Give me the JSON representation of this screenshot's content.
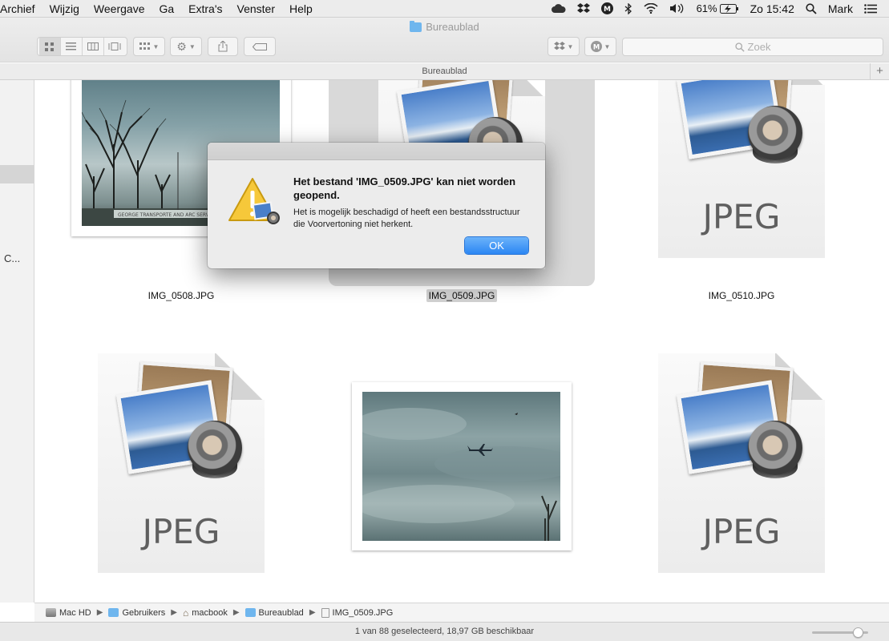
{
  "menubar": {
    "menus": [
      "Archief",
      "Wijzig",
      "Weergave",
      "Ga",
      "Extra's",
      "Venster",
      "Help"
    ],
    "battery": "61%",
    "clock": "Zo 15:42",
    "user": "Mark"
  },
  "window": {
    "title": "Bureaublad",
    "path_header": "Bureaublad",
    "search_placeholder": "Zoek"
  },
  "sidebar": {
    "truncated_label": "C..."
  },
  "files": [
    {
      "name": "IMG_0508.JPG",
      "kind": "photo"
    },
    {
      "name": "IMG_0509.JPG",
      "kind": "jpeg-icon",
      "selected": true
    },
    {
      "name": "IMG_0510.JPG",
      "kind": "jpeg-icon"
    },
    {
      "name": "",
      "kind": "jpeg-icon"
    },
    {
      "name": "",
      "kind": "photo"
    },
    {
      "name": "",
      "kind": "jpeg-icon"
    }
  ],
  "icon_text": "JPEG",
  "photo_caption": "GEORGE TRANSPORTE AND ARC SERVICE",
  "pathbar": [
    "Mac HD",
    "Gebruikers",
    "macbook",
    "Bureaublad",
    "IMG_0509.JPG"
  ],
  "status": "1 van 88 geselecteerd, 18,97 GB beschikbaar",
  "dialog": {
    "title": "Het bestand 'IMG_0509.JPG' kan niet worden geopend.",
    "message": "Het is mogelijk beschadigd of heeft een bestandsstructuur die Voorvertoning niet herkent.",
    "ok_label": "OK"
  },
  "colors": {
    "accent": "#2b86f3",
    "folder": "#6fb6ee"
  }
}
